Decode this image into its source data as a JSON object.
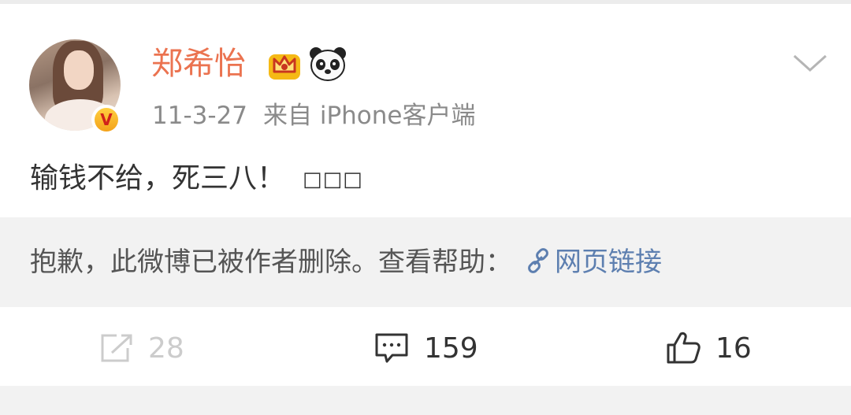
{
  "post": {
    "username": "郑希怡",
    "verified_badge": "V",
    "meta": {
      "date": "11-3-27",
      "source": "来自 iPhone客户端"
    },
    "content_text": "输钱不给，死三八！",
    "content_emoji_fallback": "□□□"
  },
  "deleted_notice": {
    "text": "抱歉，此微博已被作者删除。查看帮助：",
    "link_label": "网页链接"
  },
  "actions": {
    "share_count": "28",
    "comment_count": "159",
    "like_count": "16"
  },
  "colors": {
    "username": "#eb7350",
    "link": "#5d7fb0",
    "meta": "#8a8a8a"
  },
  "icons": [
    "crown-icon",
    "panda-icon",
    "chevron-down-icon",
    "link-icon",
    "share-icon",
    "comment-icon",
    "like-icon"
  ]
}
